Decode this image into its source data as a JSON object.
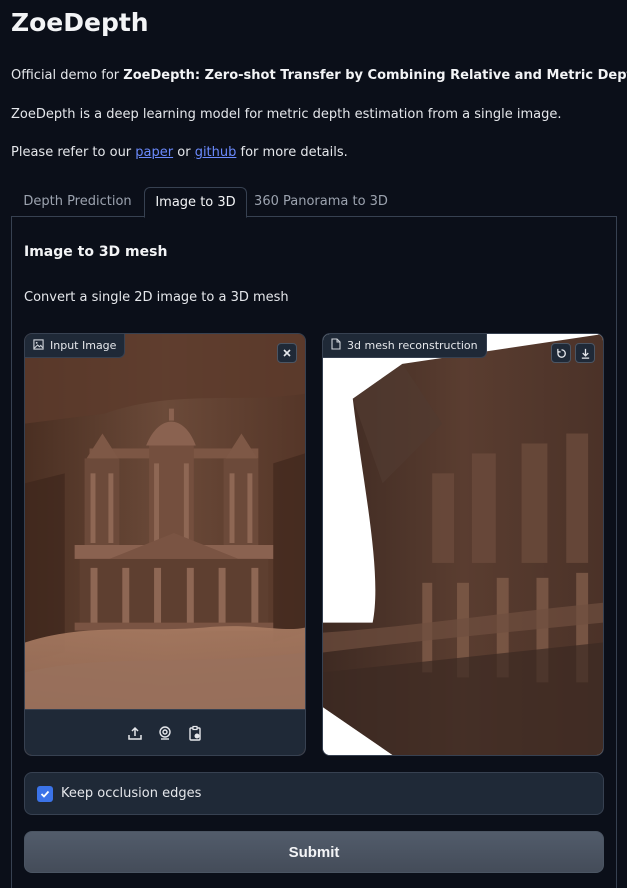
{
  "header": {
    "title": "ZoeDepth",
    "intro_prefix": "Official demo for ",
    "intro_bold": "ZoeDepth: Zero-shot Transfer by Combining Relative and Metric Depth",
    "intro_suffix": ".",
    "description": "ZoeDepth is a deep learning model for metric depth estimation from a single image.",
    "refer_prefix": "Please refer to our ",
    "paper_link": "paper",
    "refer_or": " or ",
    "github_link": "github",
    "refer_suffix": " for more details."
  },
  "tabs": [
    {
      "label": "Depth Prediction"
    },
    {
      "label": "Image to 3D"
    },
    {
      "label": "360 Panorama to 3D"
    }
  ],
  "active_tab": "Image to 3D",
  "main": {
    "section_title": "Image to 3D mesh",
    "section_desc": "Convert a single 2D image to a 3D mesh",
    "input_label": "Input Image",
    "output_label": "3d mesh reconstruction",
    "checkbox_label": "Keep occlusion edges",
    "checkbox_checked": true,
    "submit_label": "Submit"
  },
  "icons": {
    "input_label_icon": "image-icon",
    "output_label_icon": "file-icon",
    "clear": "close-icon",
    "reset": "rotate-icon",
    "download": "download-icon",
    "upload": "upload-icon",
    "webcam": "webcam-icon",
    "clipboard": "clipboard-icon",
    "check": "check-icon"
  },
  "colors": {
    "background": "#0b0f19",
    "panel": "#1f2937",
    "border": "#374151",
    "link": "#6b8afd",
    "checkbox": "#3b73e8",
    "button": "#4b5563"
  }
}
